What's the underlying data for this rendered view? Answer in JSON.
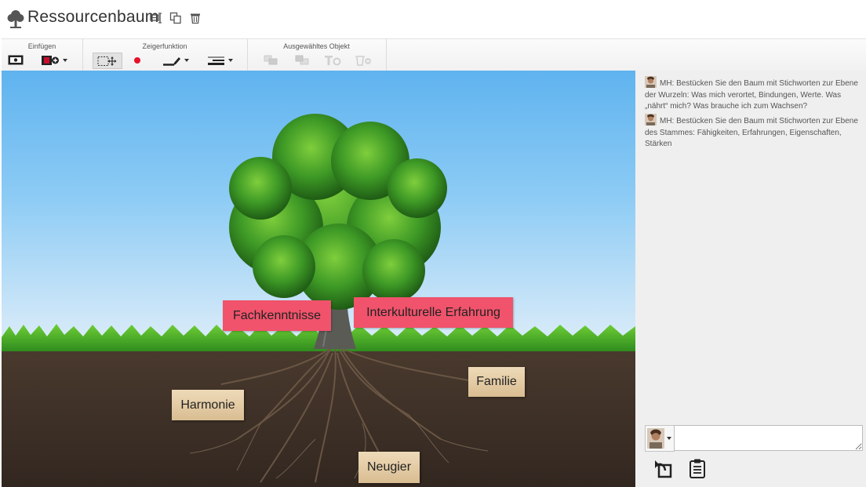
{
  "header": {
    "title": "Ressourcenbaum",
    "icons": [
      "tree-icon",
      "rename-icon",
      "copy-icon",
      "delete-icon"
    ]
  },
  "toolbar": {
    "groups": [
      {
        "label": "Einfügen",
        "buttons": [
          "insert-image-icon",
          "insert-media-icon"
        ]
      },
      {
        "label": "Zeigerfunktion",
        "buttons": [
          "select-move-icon",
          "pointer-dot-icon",
          "pen-icon",
          "line-style-icon"
        ]
      },
      {
        "label": "Ausgewähltes Objekt",
        "buttons": [
          "bring-front-icon",
          "send-back-icon",
          "text-settings-icon",
          "remove-object-icon"
        ]
      }
    ]
  },
  "canvas": {
    "notes": [
      {
        "text": "Fachkenntnisse",
        "style": "red"
      },
      {
        "text": "Interkulturelle Erfahrung",
        "style": "red"
      },
      {
        "text": "Familie",
        "style": "tan"
      },
      {
        "text": "Harmonie",
        "style": "tan"
      },
      {
        "text": "Neugier",
        "style": "tan"
      }
    ]
  },
  "chat": {
    "messages": [
      {
        "author": "MH",
        "text": "MH: Bestücken Sie den Baum mit Stichworten zur Ebene der Wurzeln: Was mich verortet, Bindungen, Werte. Was „nährt“ mich? Was brauche ich zum Wachsen?"
      },
      {
        "author": "MH",
        "text": "MH: Bestücken Sie den Baum mit Stichworten zur Ebene des Stammes: Fähigkeiten, Erfahrungen, Eigenschaften, Stärken"
      }
    ],
    "input_value": "",
    "actions": [
      "reply-icon",
      "clipboard-icon"
    ]
  },
  "colors": {
    "note_red": "#f0536b",
    "note_tan": "#e3ca9f",
    "sky": "#5fb3ef",
    "soil": "#3e3027",
    "sidebar_bg": "#efefef"
  }
}
